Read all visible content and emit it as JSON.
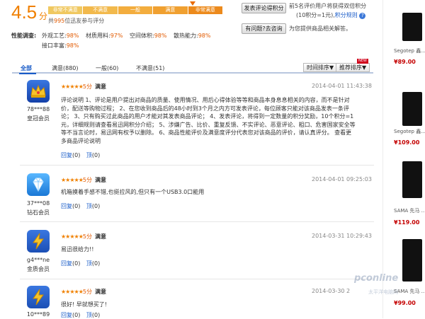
{
  "rating": {
    "score": "4.5",
    "unit": "分",
    "scale": [
      "非常不满意",
      "不满意",
      "一般",
      "满意",
      "非常满意"
    ],
    "summary_prefix": "共",
    "summary_count": "995",
    "summary_suffix": "位迅友参与评分"
  },
  "survey": {
    "label": "性能调查:",
    "items": [
      {
        "name": "外观工艺:",
        "value": "98%"
      },
      {
        "name": "材质用料:",
        "value": "97%"
      },
      {
        "name": "空间体积:",
        "value": "98%"
      },
      {
        "name": "散热能力:",
        "value": "98%"
      },
      {
        "name": "接口丰富:",
        "value": "98%"
      }
    ]
  },
  "side_actions": {
    "post_review_btn": "发表评论得积分",
    "post_review_note_1": "前5名评价用户将获得双倍积分",
    "post_review_note_2": "(10积分=1元),",
    "points_rule_link": "积分规则",
    "ask_btn": "有问题?去咨询",
    "ask_note": "为您提供商品相关解答。"
  },
  "tabs": [
    {
      "label": "全部"
    },
    {
      "label": "满意(880)"
    },
    {
      "label": "一般(60)"
    },
    {
      "label": "不满意(51)"
    }
  ],
  "sort": {
    "time": "时间排序",
    "recommend": "推荐排序",
    "new_badge": "NEW",
    "arrow": "▼"
  },
  "reviews": [
    {
      "user": "78***88",
      "level": "皇冠会员",
      "stars": "★★★★★",
      "score": "5分",
      "verdict": "满意",
      "date": "2014-04-01 11:43:38",
      "lines": [
        "评论说明   1、评论是用户提出对商品的质量、使用情况、用后心得体验等等和商品本身息息相关的内容，而不是针对",
        "价，配送等购物过程；   2、在您收到商品后的48小时到3个月之内方可发表评论，每位顾客只能对该商品发表一条评",
        "论；   3、只有购买过此商品的用户才能对其发表商品评论；   4、发表评论，将得到一定数量的积分奖励，10个积分=1",
        "元，详细规则请查看易迅网积分介绍；   5、涉嫌广告、比价、重复反馈、不实评论、恶意评论、粗口、危害国家安全等",
        "等不当言论时，易迅网有权予以删除。   6、商品性能评价及满意度评分代表您对该商品的评价，请认真评分。   查看更",
        "多商品评论说明"
      ],
      "reply": "回复",
      "reply_count": "(0)",
      "up": "顶",
      "up_count": "(0)"
    },
    {
      "user": "37***08",
      "level": "钻石会员",
      "stars": "★★★★★",
      "score": "5分",
      "verdict": "满意",
      "date": "2014-04-01 09:25:03",
      "lines": [
        "机箱摸着手感不错,也挺拉风的,但只有一个USB3.0口能用"
      ],
      "reply": "回复",
      "reply_count": "(0)",
      "up": "顶",
      "up_count": "(0)"
    },
    {
      "user": "g4***ne",
      "level": "金质会员",
      "stars": "★★★★★",
      "score": "5分",
      "verdict": "满意",
      "date": "2014-03-31 10:29:43",
      "lines": [
        "易迅很给力!!"
      ],
      "reply": "回复",
      "reply_count": "(0)",
      "up": "顶",
      "up_count": "(0)"
    },
    {
      "user": "10***89",
      "level": "",
      "stars": "★★★★★",
      "score": "5分",
      "verdict": "满意",
      "date": "2014-03-30 2",
      "lines": [
        "很好! 早就想买了!"
      ],
      "reply": "回复",
      "reply_count": "(0)",
      "up": "顶",
      "up_count": "(0)"
    }
  ],
  "sidebar": {
    "products": [
      {
        "name": "Segotep 鑫...",
        "price": "¥89.00"
      },
      {
        "name": "Segotep 鑫...",
        "price": "¥109.00"
      },
      {
        "name": "SAMA 先马 ...",
        "price": "¥119.00"
      },
      {
        "name": "SAMA 先马 ...",
        "price": "¥99.00"
      }
    ]
  },
  "watermark": {
    "text": "pconline",
    "sub": "太平洋电脑网"
  }
}
